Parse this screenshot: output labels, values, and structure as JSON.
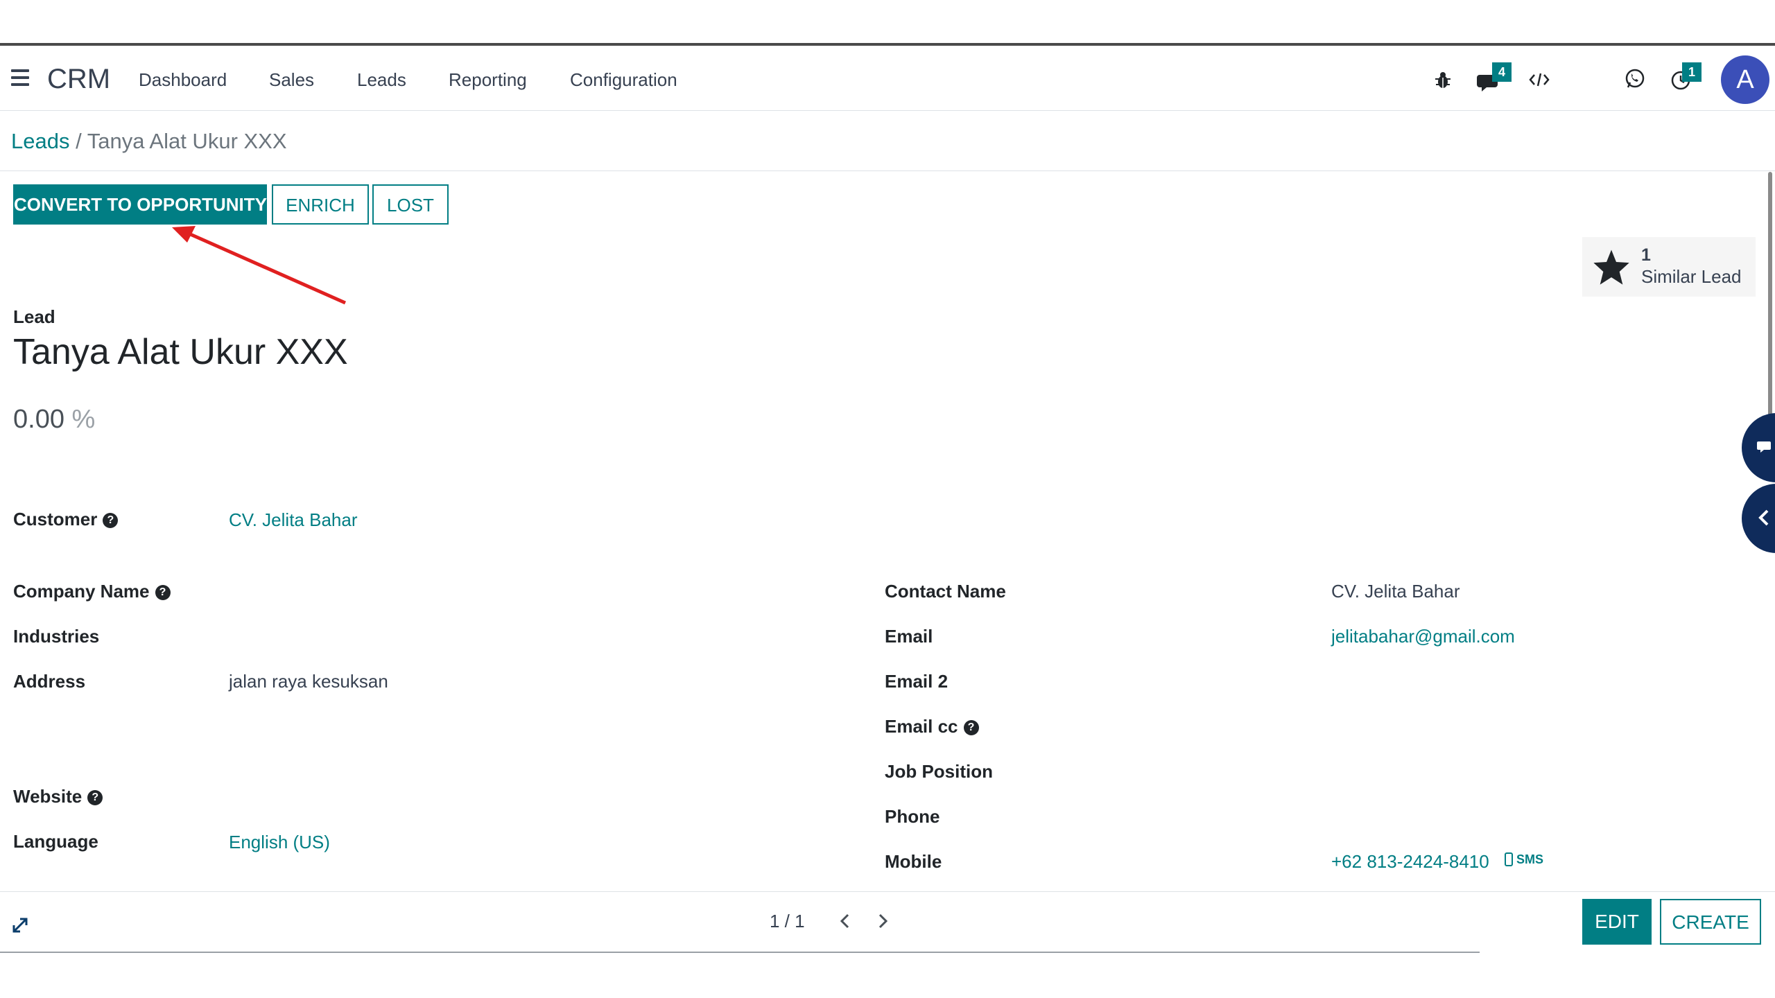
{
  "navbar": {
    "app_name": "CRM",
    "menu": [
      "Dashboard",
      "Sales",
      "Leads",
      "Reporting",
      "Configuration"
    ],
    "messages_badge": "4",
    "activities_badge": "1",
    "user_initial": "A"
  },
  "breadcrumb": {
    "parent": "Leads",
    "separator": "/",
    "current": "Tanya Alat Ukur XXX"
  },
  "actions": {
    "convert": "CONVERT TO OPPORTUNITY",
    "enrich": "ENRICH",
    "lost": "LOST"
  },
  "smart_button": {
    "count": "1",
    "label": "Similar Lead"
  },
  "lead": {
    "kind": "Lead",
    "title": "Tanya Alat Ukur XXX",
    "probability": "0.00",
    "probability_unit": "%"
  },
  "fields_left": {
    "customer_label": "Customer",
    "customer_value": "CV. Jelita Bahar",
    "company_label": "Company Name",
    "industries_label": "Industries",
    "address_label": "Address",
    "address_value": "jalan raya kesuksan",
    "website_label": "Website",
    "language_label": "Language",
    "language_value": "English (US)"
  },
  "fields_right": {
    "contact_label": "Contact Name",
    "contact_value": "CV. Jelita Bahar",
    "email_label": "Email",
    "email_value": "jelitabahar@gmail.com",
    "email2_label": "Email 2",
    "emailcc_label": "Email cc",
    "job_label": "Job Position",
    "phone_label": "Phone",
    "mobile_label": "Mobile",
    "mobile_value": "+62 813-2424-8410",
    "sms_label": "SMS"
  },
  "footer": {
    "pager": "1 / 1",
    "edit": "EDIT",
    "create": "CREATE"
  },
  "colors": {
    "primary": "#017e84",
    "avatar": "#3b4fb8",
    "side_tab": "#0f2b5b",
    "annotation_arrow": "#e02020"
  }
}
